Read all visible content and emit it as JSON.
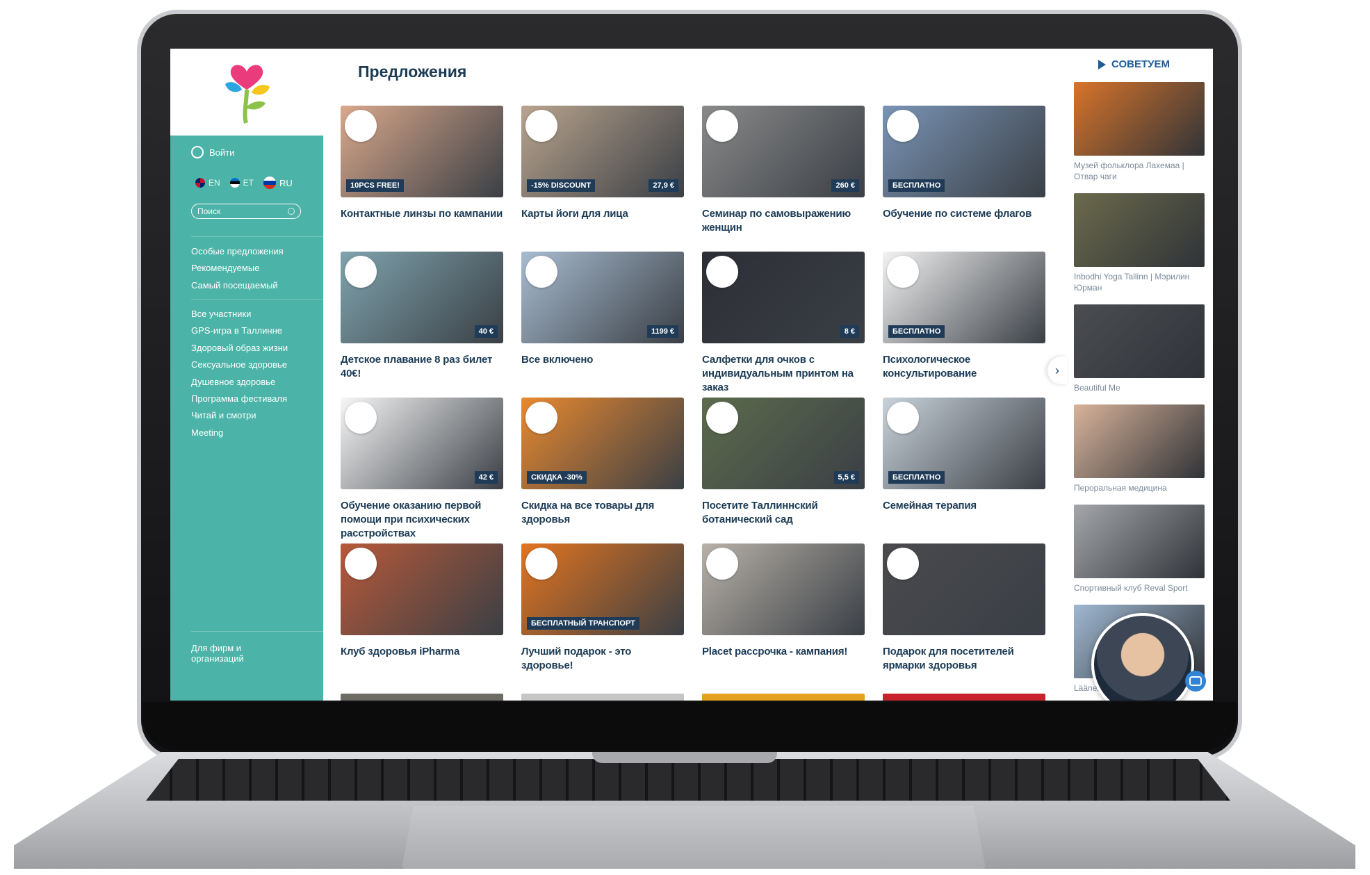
{
  "sidebar": {
    "login": "Войти",
    "languages": [
      {
        "code": "EN"
      },
      {
        "code": "ET"
      },
      {
        "code": "RU"
      }
    ],
    "search_placeholder": "Поиск",
    "group1": [
      "Особые предложения",
      "Рекомендуемые",
      "Самый посещаемый"
    ],
    "group2": [
      "Все участники",
      "GPS-игра в Таллинне",
      "Здоровый образ жизни",
      "Сексуальное здоровье",
      "Душевное здоровье",
      "Программа фестиваля",
      "Читай и смотри",
      "Meeting"
    ],
    "footer_link": "Для фирм и организаций"
  },
  "main": {
    "title": "Предложения",
    "cards": [
      {
        "title": "Контактные линзы по кампании",
        "badge": "10PCS FREE!",
        "price": "",
        "color": "#d9a88c"
      },
      {
        "title": "Карты йоги для лица",
        "badge": "-15% DISCOUNT",
        "price": "27,9 €",
        "color": "#b9a48e"
      },
      {
        "title": "Семинар по самовыражению женщин",
        "badge": "",
        "price": "260 €",
        "color": "#8a8a8a"
      },
      {
        "title": "Обучение по системе флагов",
        "badge": "БЕСПЛАТНО",
        "price": "",
        "color": "#7a94b5"
      },
      {
        "title": "Детское плавание 8 раз билет 40€!",
        "badge": "",
        "price": "40 €",
        "color": "#7fa3ad"
      },
      {
        "title": "Все включено",
        "badge": "",
        "price": "1199 €",
        "color": "#a8bcd0"
      },
      {
        "title": "Салфетки для очков с индивидуальным принтом на заказ",
        "badge": "",
        "price": "8 €",
        "color": "#2c2f35"
      },
      {
        "title": "Психологическое консультирование",
        "badge": "БЕСПЛАТНО",
        "price": "",
        "color": "#f3f3f3"
      },
      {
        "title": "Обучение оказанию первой помощи при психических расстройствах",
        "badge": "",
        "price": "42 €",
        "color": "#f7f7f7"
      },
      {
        "title": "Скидка на все товары для здоровья",
        "badge": "СКИДКА -30%",
        "price": "",
        "color": "#e9892f"
      },
      {
        "title": "Посетите Таллиннский ботанический сад",
        "badge": "",
        "price": "5,5 €",
        "color": "#5c6b4d"
      },
      {
        "title": "Семейная терапия",
        "badge": "БЕСПЛАТНО",
        "price": "",
        "color": "#c9d2da"
      },
      {
        "title": "Клуб здоровья iPharma",
        "badge": "",
        "price": "",
        "color": "#b7593a"
      },
      {
        "title": "Лучший подарок - это здоровье!",
        "badge": "БЕСПЛАТНЫЙ ТРАНСПОРТ",
        "price": "",
        "color": "#e2741f"
      },
      {
        "title": "Placet рассрочка - кампания!",
        "badge": "",
        "price": "",
        "color": "#b8b1a8"
      },
      {
        "title": "Подарок для посетителей ярмарки здоровья",
        "badge": "",
        "price": "",
        "color": "#4a4a4e"
      }
    ]
  },
  "recommend": {
    "heading": "СОВЕТУЕМ",
    "items": [
      {
        "title": "Музей фольклора Лахемаа | Отвар чаги",
        "color": "#d8742a"
      },
      {
        "title": "Inbodhi Yoga Tallinn | Мэрилин Юрман",
        "color": "#6b6a4c"
      },
      {
        "title": "Beautiful Me",
        "color": "#4b4d52"
      },
      {
        "title": "Пероральная медицина",
        "color": "#d8b39a"
      },
      {
        "title": "Спортивный клуб Reval Sport",
        "color": "#a4a6aa"
      },
      {
        "title": "Läänemere Hambakliinik",
        "color": "#9fb8d1"
      }
    ]
  }
}
